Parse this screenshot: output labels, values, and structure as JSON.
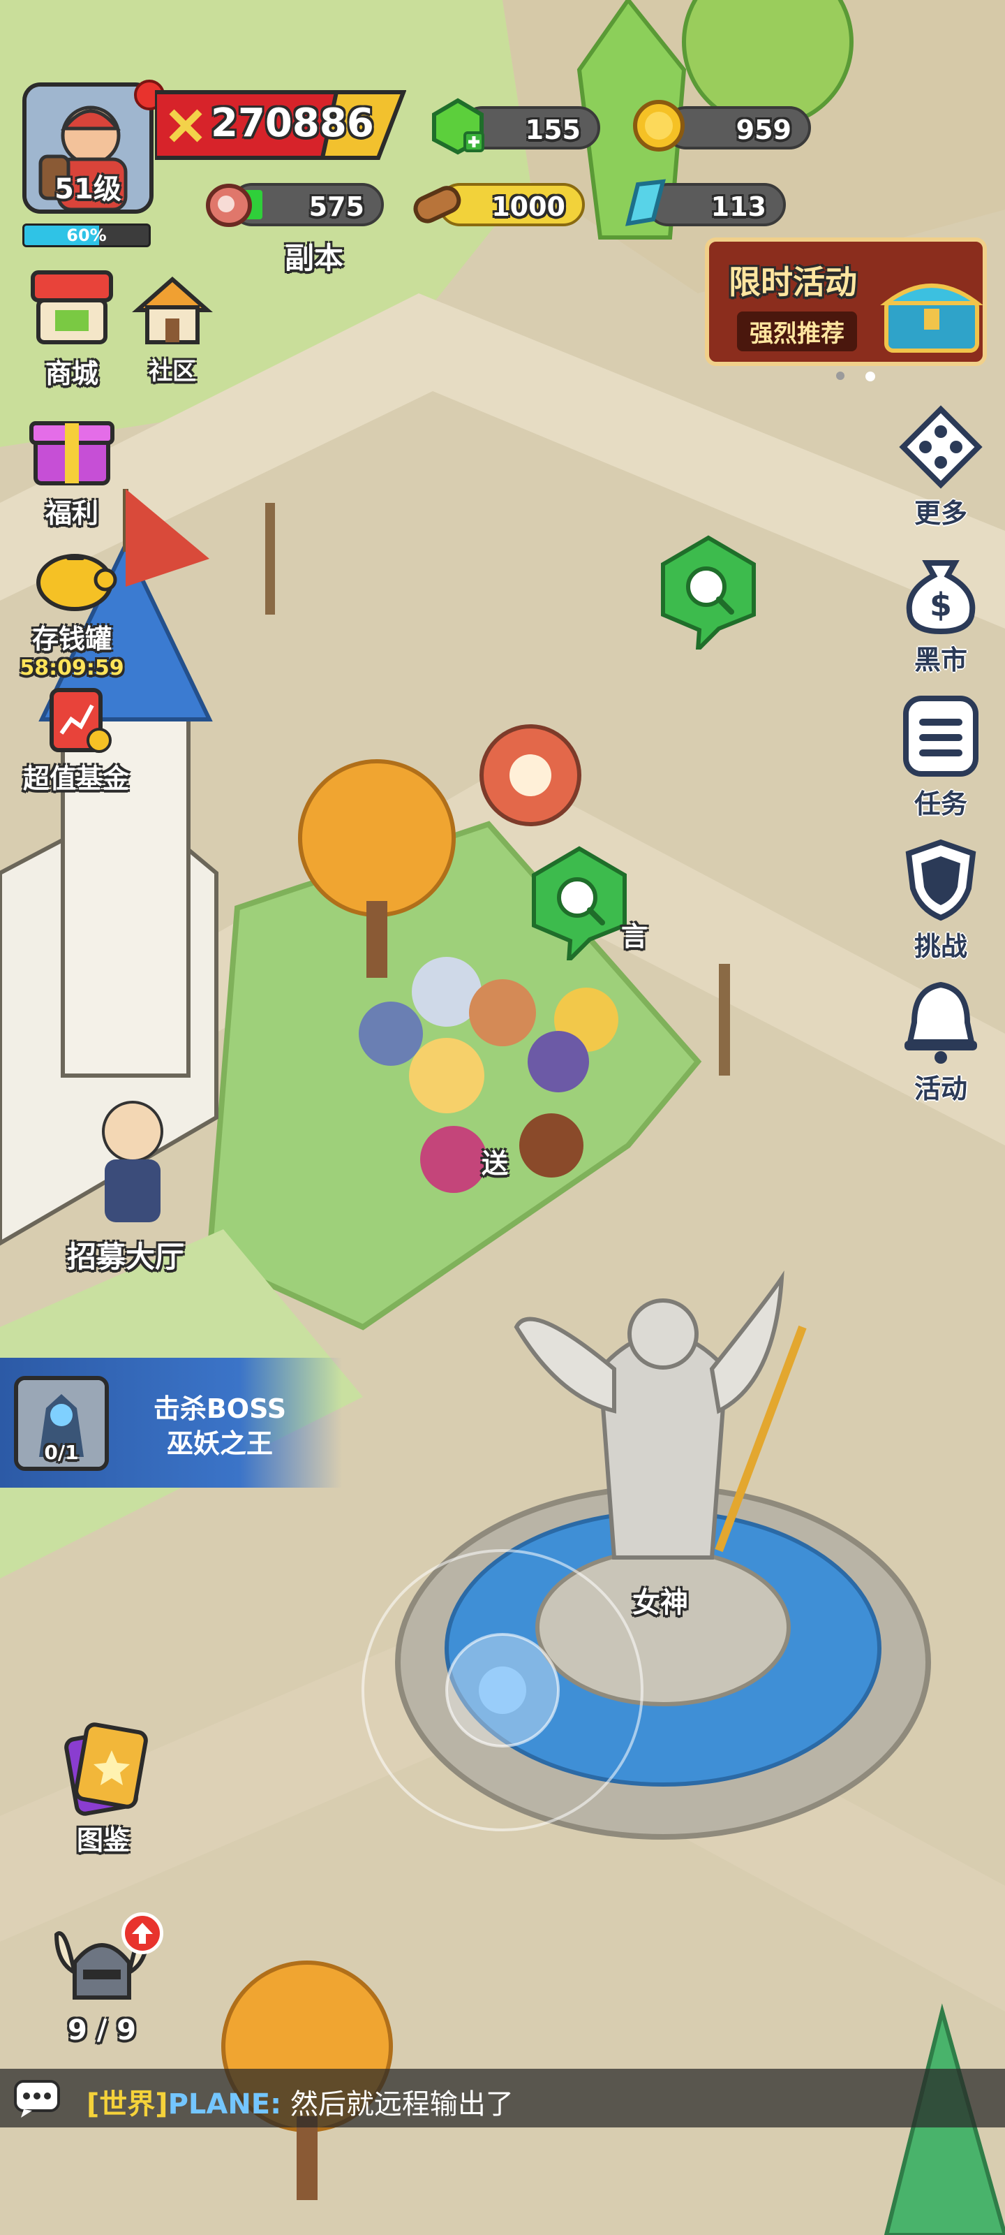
{
  "player": {
    "level_label": "51级",
    "exp_percent_label": "60%",
    "exp_fraction": 0.6,
    "power": "270886"
  },
  "resources": {
    "gems": "155",
    "coins": "959",
    "meat": "575",
    "wood": "1000",
    "crystal": "113",
    "dungeon_label": "副本"
  },
  "event_banner": {
    "title": "限时活动",
    "subtitle": "强烈推荐"
  },
  "left_menu": {
    "shop": "商城",
    "community": "社区",
    "welfare": "福利",
    "piggy_bank": "存钱罐",
    "piggy_timer": "58:09:59",
    "fund": "超值基金",
    "collection": "图鉴",
    "hero_count": "9 / 9"
  },
  "right_menu": {
    "more": "更多",
    "black_market": "黑市",
    "tasks": "任务",
    "challenge": "挑战",
    "events": "活动"
  },
  "map_labels": {
    "recruit_hall": "招募大厅",
    "goddess": "女神",
    "teleport": "送",
    "partial_sign": "言"
  },
  "quest": {
    "progress": "0/1",
    "line1": "击杀BOSS",
    "line2": "巫妖之王"
  },
  "chat": {
    "channel": "[世界]",
    "sender": "PLANE:",
    "message": "然后就远程输出了"
  }
}
